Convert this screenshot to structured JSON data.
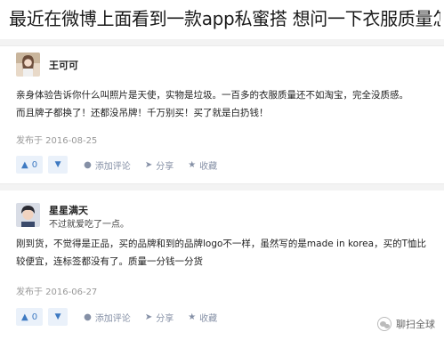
{
  "question": {
    "title": "最近在微博上面看到一款app私蜜搭 想问一下衣服质量怎..."
  },
  "answers": [
    {
      "author": {
        "name": "王可可",
        "bio": ""
      },
      "content_lines": [
        "亲身体验告诉你什么叫照片是天使，实物是垃圾。一百多的衣服质量还不如淘宝，完全没质感。",
        "而且牌子都换了！还都没吊牌！千万别买！买了就是白扔钱！"
      ],
      "date": "发布于 2016-08-25",
      "votes": "0",
      "actions": {
        "comment": "添加评论",
        "share": "分享",
        "collect": "收藏"
      }
    },
    {
      "author": {
        "name": "星星满天",
        "bio": "不过就爱吃了一点。"
      },
      "content_lines": [
        "刚到货，不觉得是正品，买的品牌和到的品牌logo不一样，虽然写的是made in korea，买的T恤比",
        "较便宜，连标签都没有了。质量一分钱一分货"
      ],
      "date": "发布于 2016-06-27",
      "votes": "0",
      "actions": {
        "comment": "添加评论",
        "share": "分享",
        "collect": "收藏"
      }
    }
  ],
  "watermark": {
    "text": "聊扫全球"
  },
  "icons": {
    "upvote": "triangle-up-icon",
    "downvote": "triangle-down-icon",
    "comment": "speech-bubble-icon",
    "share": "paper-plane-icon",
    "collect": "star-icon"
  }
}
